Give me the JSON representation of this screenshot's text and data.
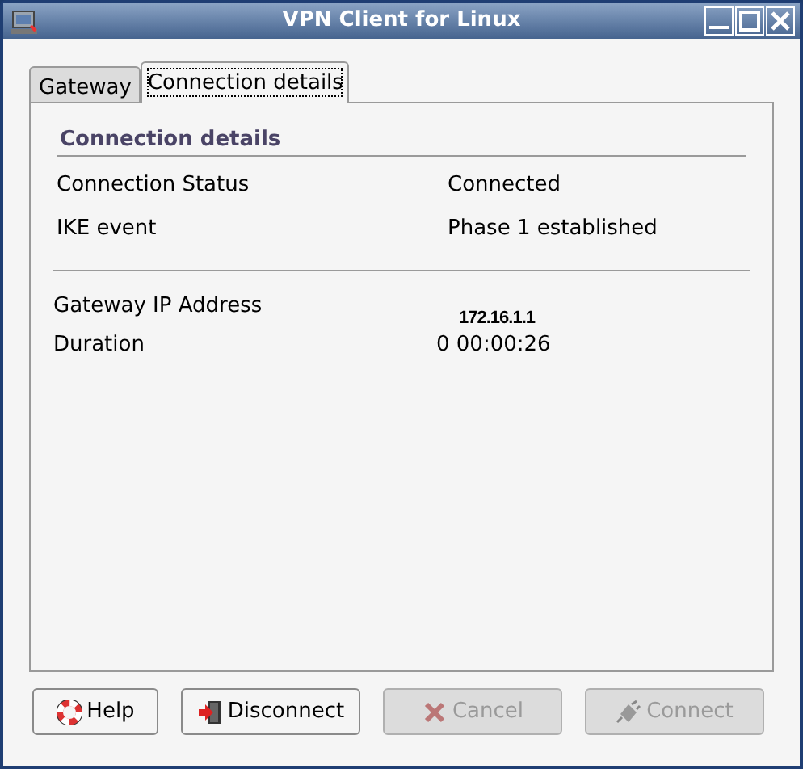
{
  "window": {
    "title": "VPN Client for Linux"
  },
  "tabs": [
    {
      "label": "Gateway",
      "selected": false
    },
    {
      "label": "Connection details",
      "selected": true
    }
  ],
  "section": {
    "heading": "Connection details",
    "rows": [
      {
        "label": "Connection Status",
        "value": "Connected"
      },
      {
        "label": "IKE event",
        "value": "Phase 1 established"
      }
    ]
  },
  "details": [
    {
      "label": "Gateway IP Address",
      "value": "172.16.1.1",
      "kind": "bold"
    },
    {
      "label": "Duration",
      "value": "0 00:00:26",
      "kind": "plain"
    }
  ],
  "buttons": [
    {
      "label": "Help",
      "kind": "help",
      "disabled": false
    },
    {
      "label": "Disconnect",
      "kind": "disconnect",
      "disabled": false
    },
    {
      "label": "Cancel",
      "kind": "cancel",
      "disabled": true
    },
    {
      "label": "Connect",
      "kind": "connect",
      "disabled": true
    }
  ]
}
